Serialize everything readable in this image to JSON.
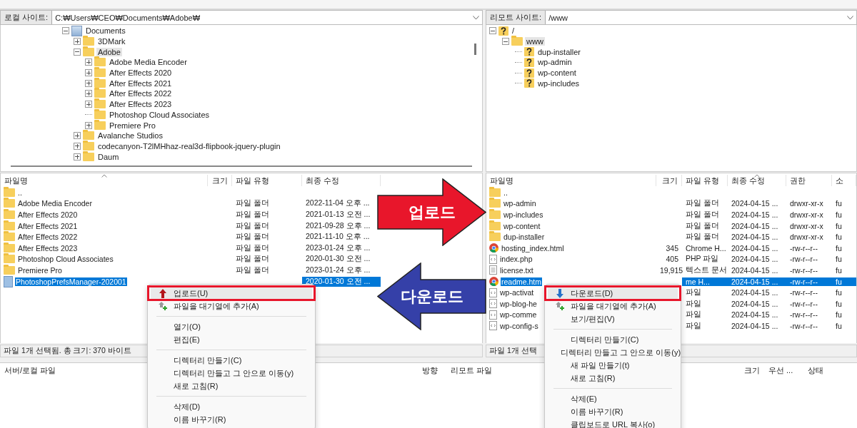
{
  "local": {
    "site_label": "로컬 사이트:",
    "path": "C:₩Users₩CEO₩Documents₩Adobe₩",
    "tree": [
      {
        "label": "Documents",
        "kind": "library",
        "expandable": true,
        "expanded": true,
        "selected": false,
        "children": [
          {
            "label": "3DMark",
            "kind": "folder",
            "expandable": true,
            "expanded": false,
            "selected": false
          },
          {
            "label": "Adobe",
            "kind": "folder",
            "expandable": true,
            "expanded": true,
            "selected": true,
            "children": [
              {
                "label": "Adobe Media Encoder",
                "kind": "folder",
                "expandable": true,
                "expanded": false,
                "selected": false
              },
              {
                "label": "After Effects 2020",
                "kind": "folder",
                "expandable": true,
                "expanded": false,
                "selected": false
              },
              {
                "label": "After Effects 2021",
                "kind": "folder",
                "expandable": true,
                "expanded": false,
                "selected": false
              },
              {
                "label": "After Effects 2022",
                "kind": "folder",
                "expandable": true,
                "expanded": false,
                "selected": false
              },
              {
                "label": "After Effects 2023",
                "kind": "folder",
                "expandable": true,
                "expanded": false,
                "selected": false
              },
              {
                "label": "Photoshop Cloud Associates",
                "kind": "folder",
                "expandable": false,
                "selected": false
              },
              {
                "label": "Premiere Pro",
                "kind": "folder",
                "expandable": true,
                "expanded": false,
                "selected": false
              }
            ]
          },
          {
            "label": "Avalanche Studios",
            "kind": "folder",
            "expandable": true,
            "expanded": false,
            "selected": false
          },
          {
            "label": "codecanyon-T2lMHhaz-real3d-flipbook-jquery-plugin",
            "kind": "folder",
            "expandable": true,
            "expanded": false,
            "selected": false
          },
          {
            "label": "Daum",
            "kind": "folder",
            "expandable": true,
            "expanded": false,
            "selected": false
          }
        ]
      }
    ],
    "columns": [
      {
        "label": "파일명",
        "sorted": true
      },
      {
        "label": "크기",
        "sorted": false
      },
      {
        "label": "파일 유형",
        "sorted": false
      },
      {
        "label": "최종 수정",
        "sorted": false
      }
    ],
    "rows": [
      {
        "kind": "folder",
        "name": "..",
        "selected": false
      },
      {
        "kind": "folder",
        "name": "Adobe Media Encoder",
        "type": "파일 폴더",
        "modified": "2022-11-04 오후 ...",
        "selected": false
      },
      {
        "kind": "folder",
        "name": "After Effects 2020",
        "type": "파일 폴더",
        "modified": "2021-01-13 오전 ...",
        "selected": false
      },
      {
        "kind": "folder",
        "name": "After Effects 2021",
        "type": "파일 폴더",
        "modified": "2021-09-28 오후 ...",
        "selected": false
      },
      {
        "kind": "folder",
        "name": "After Effects 2022",
        "type": "파일 폴더",
        "modified": "2021-11-10 오후 ...",
        "selected": false
      },
      {
        "kind": "folder",
        "name": "After Effects 2023",
        "type": "파일 폴더",
        "modified": "2023-01-24 오후 ...",
        "selected": false
      },
      {
        "kind": "folder",
        "name": "Photoshop Cloud Associates",
        "type": "파일 폴더",
        "modified": "2020-01-30 오전 ...",
        "selected": false
      },
      {
        "kind": "folder",
        "name": "Premiere Pro",
        "type": "파일 폴더",
        "modified": "2023-01-24 오후 ...",
        "selected": false
      },
      {
        "kind": "file",
        "name": "PhotoshopPrefsManager-202001",
        "modified": "2020-01-30 오전 ...",
        "selected": true
      }
    ],
    "status": "파일 1개 선택됨. 총 크기: 370 바이트",
    "menu": [
      {
        "kind": "upload",
        "label": "업로드(U)",
        "highlighted": true
      },
      {
        "kind": "queue",
        "label": "파일을 대기열에 추가(A)",
        "highlighted": false
      },
      {
        "kind": "separator"
      },
      {
        "kind": "plain",
        "label": "열기(O)",
        "highlighted": false
      },
      {
        "kind": "plain",
        "label": "편집(E)",
        "highlighted": false
      },
      {
        "kind": "separator"
      },
      {
        "kind": "plain",
        "label": "디렉터리 만들기(C)",
        "highlighted": false
      },
      {
        "kind": "plain",
        "label": "디렉터리 만들고 그 안으로 이동(y)",
        "highlighted": false
      },
      {
        "kind": "plain",
        "label": "새로 고침(R)",
        "highlighted": false
      },
      {
        "kind": "separator"
      },
      {
        "kind": "plain",
        "label": "삭제(D)",
        "highlighted": false
      },
      {
        "kind": "plain",
        "label": "이름 바꾸기(R)",
        "highlighted": false
      }
    ]
  },
  "remote": {
    "site_label": "리모트 사이트:",
    "path": "/www",
    "tree": [
      {
        "label": "/",
        "kind": "unknown",
        "expandable": true,
        "expanded": true,
        "selected": false,
        "children": [
          {
            "label": "www",
            "kind": "folder",
            "expandable": true,
            "expanded": true,
            "selected": true,
            "children": [
              {
                "label": "dup-installer",
                "kind": "unknown",
                "expandable": false,
                "selected": false
              },
              {
                "label": "wp-admin",
                "kind": "unknown",
                "expandable": false,
                "selected": false
              },
              {
                "label": "wp-content",
                "kind": "unknown",
                "expandable": false,
                "selected": false
              },
              {
                "label": "wp-includes",
                "kind": "unknown",
                "expandable": false,
                "selected": false
              }
            ]
          }
        ]
      }
    ],
    "columns": [
      {
        "label": "파일명",
        "sorted": false
      },
      {
        "label": "크기",
        "sorted": false
      },
      {
        "label": "파일 유형",
        "sorted": false
      },
      {
        "label": "최종 수정",
        "sorted": true
      },
      {
        "label": "권한",
        "sorted": false
      },
      {
        "label": "소",
        "sorted": false
      }
    ],
    "rows": [
      {
        "kind": "folder",
        "name": "..",
        "selected": false
      },
      {
        "kind": "folder",
        "name": "wp-admin",
        "type": "파일 폴더",
        "modified": "2024-04-15 ...",
        "permissions": "drwxr-xr-x",
        "owner": "fu",
        "selected": false
      },
      {
        "kind": "folder",
        "name": "wp-includes",
        "type": "파일 폴더",
        "modified": "2024-04-15 ...",
        "permissions": "drwxr-xr-x",
        "owner": "fu",
        "selected": false
      },
      {
        "kind": "folder",
        "name": "wp-content",
        "type": "파일 폴더",
        "modified": "2024-04-15 ...",
        "permissions": "drwxr-xr-x",
        "owner": "fu",
        "selected": false
      },
      {
        "kind": "folder",
        "name": "dup-installer",
        "type": "파일 폴더",
        "modified": "2024-04-15 ...",
        "permissions": "drwxr-xr-x",
        "owner": "fu",
        "selected": false
      },
      {
        "kind": "browser",
        "name": "hosting_index.html",
        "size": "345",
        "type": "Chrome H...",
        "modified": "2024-04-15 ...",
        "permissions": "-rw-r--r--",
        "owner": "fu",
        "selected": false
      },
      {
        "kind": "code",
        "name": "index.php",
        "size": "405",
        "type": "PHP 파일",
        "modified": "2024-04-15 ...",
        "permissions": "-rw-r--r--",
        "owner": "fu",
        "selected": false
      },
      {
        "kind": "text",
        "name": "license.txt",
        "size": "19,915",
        "type": "텍스트 문서",
        "modified": "2024-04-15 ...",
        "permissions": "-rw-r--r--",
        "owner": "fu",
        "selected": false
      },
      {
        "kind": "browser",
        "name": "readme.htm",
        "type": "me H...",
        "modified": "2024-04-15 ...",
        "permissions": "-rw-r--r--",
        "owner": "fu",
        "selected": true
      },
      {
        "kind": "code",
        "name": "wp-activat",
        "type": "파일",
        "modified": "2024-04-15 ...",
        "permissions": "-rw-r--r--",
        "owner": "fu",
        "selected": false
      },
      {
        "kind": "code",
        "name": "wp-blog-he",
        "type": "파일",
        "modified": "2024-04-15 ...",
        "permissions": "-rw-r--r--",
        "owner": "fu",
        "selected": false
      },
      {
        "kind": "code",
        "name": "wp-comme",
        "type": "파일",
        "modified": "2024-04-15 ...",
        "permissions": "-rw-r--r--",
        "owner": "fu",
        "selected": false
      },
      {
        "kind": "code",
        "name": "wp-config-s",
        "type": "파일",
        "modified": "2024-04-15 ...",
        "permissions": "-rw-r--r--",
        "owner": "fu",
        "selected": false
      }
    ],
    "status": "파일 1개 선택",
    "menu": [
      {
        "kind": "download",
        "label": "다운로드(D)",
        "highlighted": true
      },
      {
        "kind": "queue",
        "label": "파일을 대기열에 추가(A)",
        "highlighted": false
      },
      {
        "kind": "plain",
        "label": "보기/편집(V)",
        "highlighted": false
      },
      {
        "kind": "separator"
      },
      {
        "kind": "plain",
        "label": "디렉터리 만들기(C)",
        "highlighted": false
      },
      {
        "kind": "plain",
        "label": "디렉터리 만들고 그 안으로 이동(y)",
        "highlighted": false
      },
      {
        "kind": "plain",
        "label": "새 파일 만들기(t)",
        "highlighted": false
      },
      {
        "kind": "plain",
        "label": "새로 고침(R)",
        "highlighted": false
      },
      {
        "kind": "separator"
      },
      {
        "kind": "plain",
        "label": "삭제(E)",
        "highlighted": false
      },
      {
        "kind": "plain",
        "label": "이름 바꾸기(R)",
        "highlighted": false
      },
      {
        "kind": "plain",
        "label": "클립보드로 URL 복사(o)",
        "highlighted": false
      }
    ]
  },
  "queue": {
    "columns": [
      "서버/로컬 파일",
      "방향",
      "리모트 파일",
      "크기",
      "우선 ...",
      "상태"
    ]
  },
  "annotations": [
    {
      "kind": "right",
      "label": "업로드",
      "color": "#e8162b"
    },
    {
      "kind": "left",
      "label": "다운로드",
      "color": "#3540a8"
    }
  ]
}
